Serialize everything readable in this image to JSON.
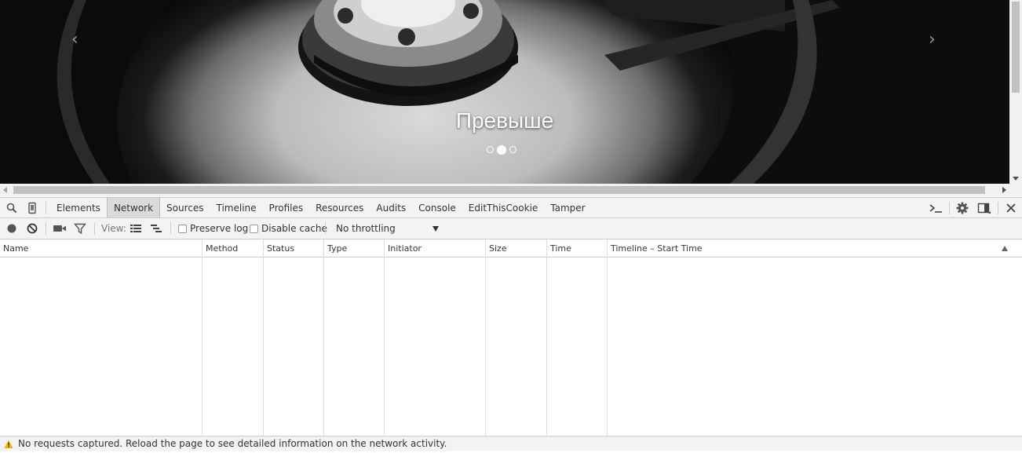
{
  "page": {
    "slide_caption": "Превыше",
    "prev_arrow": "‹",
    "next_arrow": "›",
    "indicators": [
      {
        "active": false
      },
      {
        "active": true
      },
      {
        "active": false
      }
    ]
  },
  "devtools": {
    "tabs": [
      "Elements",
      "Network",
      "Sources",
      "Timeline",
      "Profiles",
      "Resources",
      "Audits",
      "Console",
      "EditThisCookie",
      "Tamper"
    ],
    "selected_tab": "Network",
    "toolbar": {
      "view_label": "View:",
      "preserve_log_label": "Preserve log",
      "disable_cache_label": "Disable cache",
      "throttling_value": "No throttling"
    },
    "columns": [
      "Name",
      "Method",
      "Status",
      "Type",
      "Initiator",
      "Size",
      "Time",
      "Timeline – Start Time"
    ],
    "status_message": "No requests captured. Reload the page to see detailed information on the network activity."
  },
  "icons": [
    "search-icon",
    "device-mode-icon",
    "record-icon",
    "clear-icon",
    "capture-screenshots-icon",
    "filter-icon",
    "large-rows-icon",
    "overview-icon",
    "console-drawer-icon",
    "settings-icon",
    "dock-side-icon",
    "close-icon",
    "warning-icon"
  ],
  "colors": {
    "record": "#555555",
    "warning": "#f0b400"
  }
}
